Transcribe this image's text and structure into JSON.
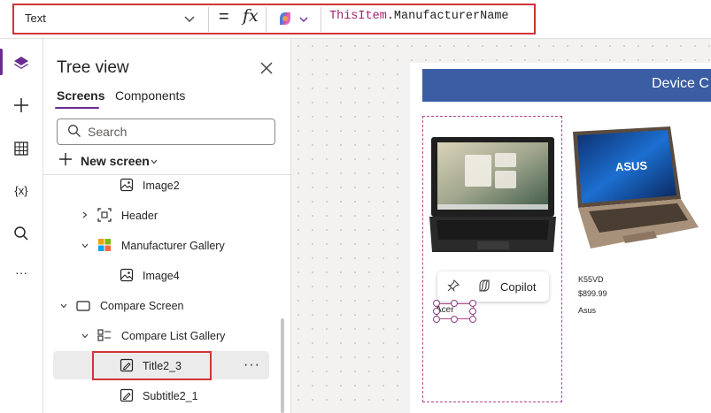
{
  "formula_bar": {
    "property": "Text",
    "equals": "=",
    "fx": "fx",
    "formula_keyword": "ThisItem",
    "formula_rest": ".ManufacturerName"
  },
  "rail": {
    "icons": [
      "layers-icon",
      "plus-icon",
      "table-icon",
      "variables-icon",
      "search-icon",
      "more-icon"
    ],
    "variables_glyph": "{x}",
    "more_glyph": "···"
  },
  "tree": {
    "title": "Tree view",
    "tabs": [
      "Screens",
      "Components"
    ],
    "search_placeholder": "Search",
    "new_screen": "New screen",
    "nodes": [
      {
        "label": "Image2"
      },
      {
        "label": "Header"
      },
      {
        "label": "Manufacturer Gallery"
      },
      {
        "label": "Image4"
      },
      {
        "label": "Compare Screen"
      },
      {
        "label": "Compare List Gallery"
      },
      {
        "label": "Title2_3"
      },
      {
        "label": "Subtitle2_1"
      }
    ],
    "more_glyph": "···"
  },
  "canvas": {
    "header_text": "Device C",
    "copilot_label": "Copilot",
    "products": [
      {
        "name": "Acer",
        "price": "",
        "brand": ""
      },
      {
        "name": "K55VD",
        "price": "$899.99",
        "brand": "Asus"
      }
    ],
    "laptop_logo": "ASUS"
  },
  "colors": {
    "accent": "#6b2c91",
    "highlight": "#d13438",
    "header": "#3a5da3",
    "formula_keyword": "#a3216f"
  }
}
